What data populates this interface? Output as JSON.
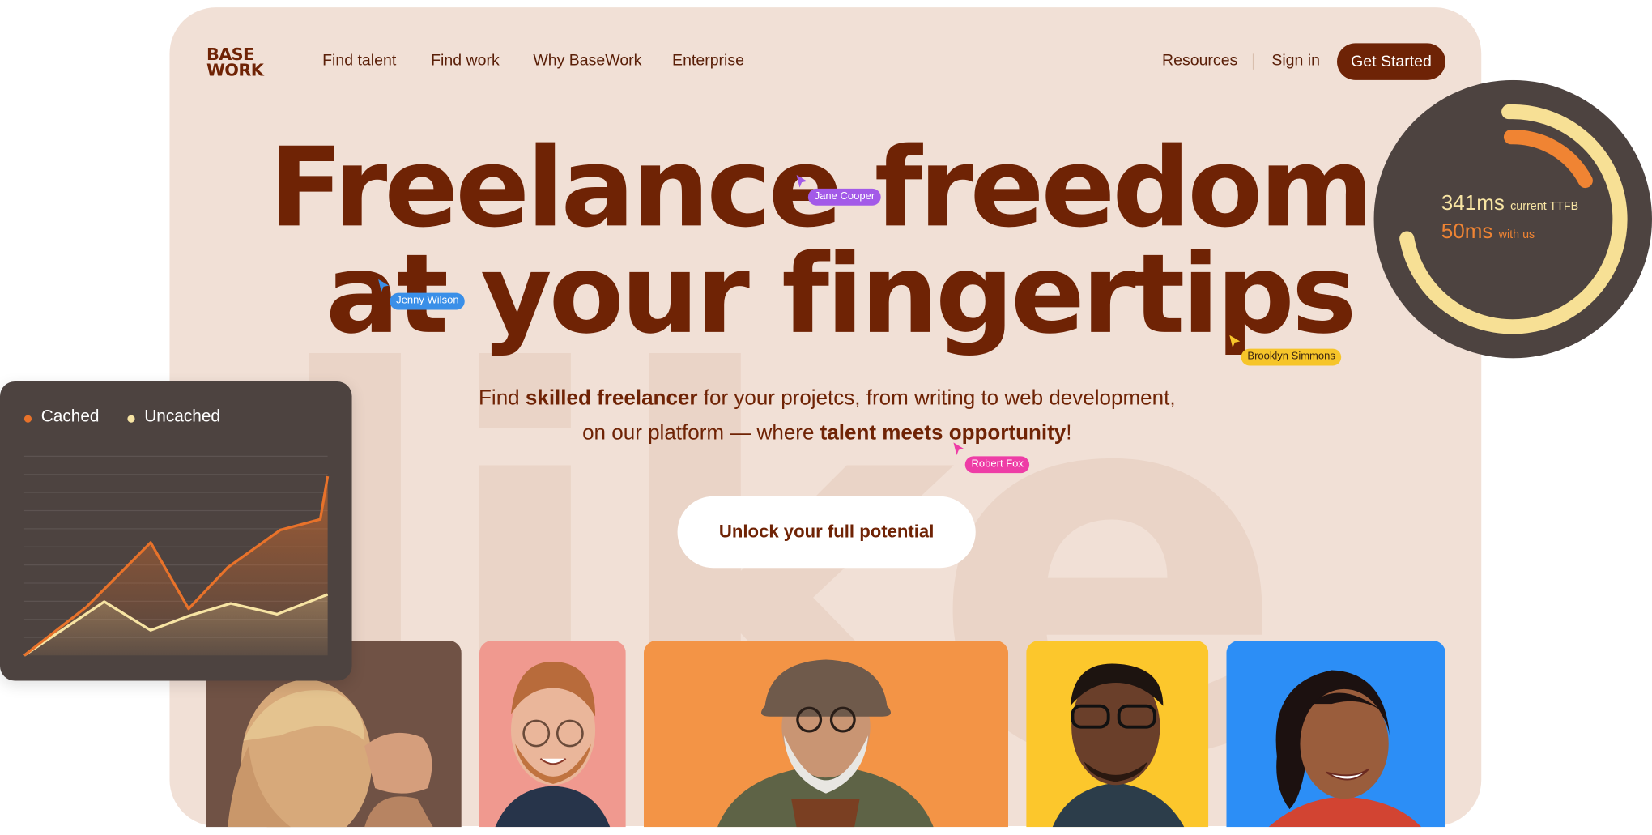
{
  "brand": {
    "line1": "BASE",
    "line2": "WORK"
  },
  "nav": {
    "links": [
      "Find talent",
      "Find work",
      "Why BaseWork",
      "Enterprise"
    ],
    "resources": "Resources",
    "sign_in": "Sign in",
    "get_started": "Get Started"
  },
  "hero": {
    "headline_line1": "Freelance freedom",
    "headline_line2": "at your fingertips",
    "sub_line1": {
      "a": "Find ",
      "b": "skilled freelancer",
      "c": " for your projetcs, from writing to web development,"
    },
    "sub_line2": {
      "a": "on our platform — where ",
      "b": "talent meets opportunity",
      "c": "!"
    },
    "cta": "Unlock your full potential"
  },
  "cursors": [
    {
      "name": "Jane Cooper",
      "color": "#a35ae8"
    },
    {
      "name": "Jenny Wilson",
      "color": "#3a8fe8"
    },
    {
      "name": "Brooklyn Simmons",
      "color": "#f6c52a"
    },
    {
      "name": "Robert Fox",
      "color": "#ee3da6"
    }
  ],
  "gauge": {
    "current_value": "341ms",
    "current_label": "current TTFB",
    "with_us_value": "50ms",
    "with_us_label": "with us"
  },
  "chart_data": {
    "type": "area",
    "legend": [
      "Cached",
      "Uncached"
    ],
    "grid": true,
    "series": [
      {
        "name": "Cached",
        "color": "#e8722a",
        "values": [
          0,
          27,
          63,
          26,
          49,
          70,
          76,
          100
        ]
      },
      {
        "name": "Uncached",
        "color": "#f7e4a3",
        "values": [
          0,
          30,
          14,
          22,
          29,
          23,
          34
        ]
      }
    ]
  },
  "photos": [
    {
      "subject": "man-back-of-head",
      "bg": "#7a5a4a"
    },
    {
      "subject": "redhead-man-glasses",
      "bg": "#f0998f"
    },
    {
      "subject": "bearded-man-hat",
      "bg": "#f39446"
    },
    {
      "subject": "man-glasses-yellow",
      "bg": "#fcc72c"
    },
    {
      "subject": "smiling-woman",
      "bg": "#2c8ef6"
    }
  ]
}
